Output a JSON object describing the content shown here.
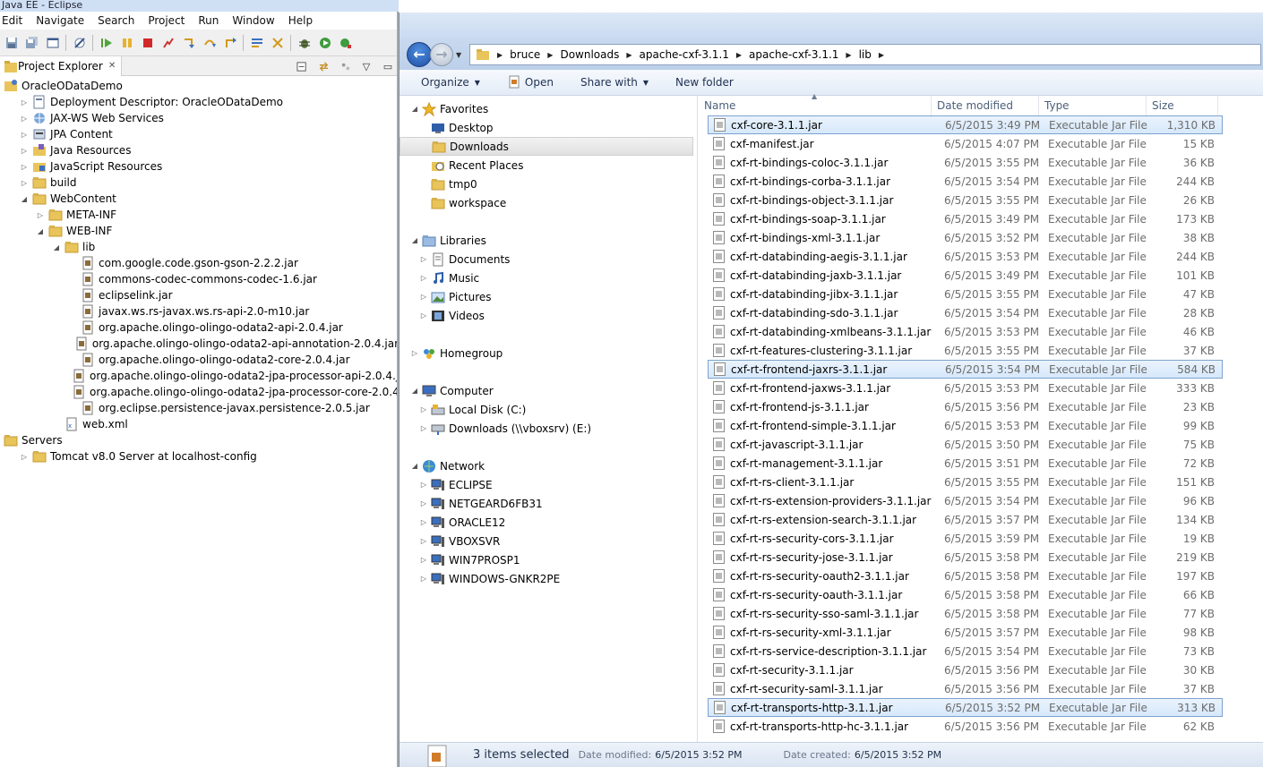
{
  "eclipse": {
    "title": "Java EE - Eclipse",
    "menu": [
      "Edit",
      "Navigate",
      "Search",
      "Project",
      "Run",
      "Window",
      "Help"
    ],
    "view_title": "Project Explorer",
    "view_close": "✕",
    "tree": [
      {
        "label": "OracleODataDemo",
        "level": 0,
        "twist": "",
        "icon": "project"
      },
      {
        "label": "Deployment Descriptor: OracleODataDemo",
        "level": 1,
        "twist": "closed",
        "icon": "descriptor"
      },
      {
        "label": "JAX-WS Web Services",
        "level": 1,
        "twist": "closed",
        "icon": "webservices"
      },
      {
        "label": "JPA Content",
        "level": 1,
        "twist": "closed",
        "icon": "jpa"
      },
      {
        "label": "Java Resources",
        "level": 1,
        "twist": "closed",
        "icon": "javares"
      },
      {
        "label": "JavaScript Resources",
        "level": 1,
        "twist": "closed",
        "icon": "jsres"
      },
      {
        "label": "build",
        "level": 1,
        "twist": "closed",
        "icon": "folder"
      },
      {
        "label": "WebContent",
        "level": 1,
        "twist": "open",
        "icon": "folder"
      },
      {
        "label": "META-INF",
        "level": 2,
        "twist": "closed",
        "icon": "folder"
      },
      {
        "label": "WEB-INF",
        "level": 2,
        "twist": "open",
        "icon": "folder"
      },
      {
        "label": "lib",
        "level": 3,
        "twist": "open",
        "icon": "folder"
      },
      {
        "label": "com.google.code.gson-gson-2.2.2.jar",
        "level": 4,
        "twist": "",
        "icon": "jar"
      },
      {
        "label": "commons-codec-commons-codec-1.6.jar",
        "level": 4,
        "twist": "",
        "icon": "jar"
      },
      {
        "label": "eclipselink.jar",
        "level": 4,
        "twist": "",
        "icon": "jar"
      },
      {
        "label": "javax.ws.rs-javax.ws.rs-api-2.0-m10.jar",
        "level": 4,
        "twist": "",
        "icon": "jar"
      },
      {
        "label": "org.apache.olingo-olingo-odata2-api-2.0.4.jar",
        "level": 4,
        "twist": "",
        "icon": "jar"
      },
      {
        "label": "org.apache.olingo-olingo-odata2-api-annotation-2.0.4.jar",
        "level": 4,
        "twist": "",
        "icon": "jar"
      },
      {
        "label": "org.apache.olingo-olingo-odata2-core-2.0.4.jar",
        "level": 4,
        "twist": "",
        "icon": "jar"
      },
      {
        "label": "org.apache.olingo-olingo-odata2-jpa-processor-api-2.0.4.jar",
        "level": 4,
        "twist": "",
        "icon": "jar"
      },
      {
        "label": "org.apache.olingo-olingo-odata2-jpa-processor-core-2.0.4.jar",
        "level": 4,
        "twist": "",
        "icon": "jar"
      },
      {
        "label": "org.eclipse.persistence-javax.persistence-2.0.5.jar",
        "level": 4,
        "twist": "",
        "icon": "jar"
      },
      {
        "label": "web.xml",
        "level": 3,
        "twist": "",
        "icon": "xml"
      },
      {
        "label": "Servers",
        "level": 0,
        "twist": "",
        "icon": "folder"
      },
      {
        "label": "Tomcat v8.0 Server at localhost-config",
        "level": 1,
        "twist": "closed",
        "icon": "folder"
      }
    ]
  },
  "explorer": {
    "breadcrumb": [
      "bruce",
      "Downloads",
      "apache-cxf-3.1.1",
      "apache-cxf-3.1.1",
      "lib"
    ],
    "commands": [
      {
        "label": "Organize",
        "dropdown": true,
        "icon": ""
      },
      {
        "label": "Open",
        "dropdown": false,
        "icon": "open"
      },
      {
        "label": "Share with",
        "dropdown": true,
        "icon": ""
      },
      {
        "label": "New folder",
        "dropdown": false,
        "icon": ""
      }
    ],
    "nav": [
      {
        "label": "Favorites",
        "level": 0,
        "twist": "open",
        "icon": "star",
        "gap": 0
      },
      {
        "label": "Desktop",
        "level": 1,
        "twist": "",
        "icon": "desktop",
        "gap": 0
      },
      {
        "label": "Downloads",
        "level": 1,
        "twist": "",
        "icon": "folder",
        "gap": 0,
        "selected": true
      },
      {
        "label": "Recent Places",
        "level": 1,
        "twist": "",
        "icon": "recent",
        "gap": 0
      },
      {
        "label": "tmp0",
        "level": 1,
        "twist": "",
        "icon": "folder",
        "gap": 0
      },
      {
        "label": "workspace",
        "level": 1,
        "twist": "",
        "icon": "folder",
        "gap": 0
      },
      {
        "label": "Libraries",
        "level": 0,
        "twist": "open",
        "icon": "library",
        "gap": 21
      },
      {
        "label": "Documents",
        "level": 1,
        "twist": "closed",
        "icon": "documents",
        "gap": 0
      },
      {
        "label": "Music",
        "level": 1,
        "twist": "closed",
        "icon": "music",
        "gap": 0
      },
      {
        "label": "Pictures",
        "level": 1,
        "twist": "closed",
        "icon": "pictures",
        "gap": 0
      },
      {
        "label": "Videos",
        "level": 1,
        "twist": "closed",
        "icon": "videos",
        "gap": 0
      },
      {
        "label": "Homegroup",
        "level": 0,
        "twist": "closed",
        "icon": "homegroup",
        "gap": 21
      },
      {
        "label": "Computer",
        "level": 0,
        "twist": "open",
        "icon": "computer",
        "gap": 21
      },
      {
        "label": "Local Disk (C:)",
        "level": 1,
        "twist": "closed",
        "icon": "disk",
        "gap": 0
      },
      {
        "label": "Downloads (\\\\vboxsrv) (E:)",
        "level": 1,
        "twist": "closed",
        "icon": "netdrive",
        "gap": 0
      },
      {
        "label": "Network",
        "level": 0,
        "twist": "open",
        "icon": "network",
        "gap": 21
      },
      {
        "label": "ECLIPSE",
        "level": 1,
        "twist": "closed",
        "icon": "pc",
        "gap": 0
      },
      {
        "label": "NETGEARD6FB31",
        "level": 1,
        "twist": "closed",
        "icon": "pc",
        "gap": 0
      },
      {
        "label": "ORACLE12",
        "level": 1,
        "twist": "closed",
        "icon": "pc",
        "gap": 0
      },
      {
        "label": "VBOXSVR",
        "level": 1,
        "twist": "closed",
        "icon": "pc",
        "gap": 0
      },
      {
        "label": "WIN7PROSP1",
        "level": 1,
        "twist": "closed",
        "icon": "pc",
        "gap": 0
      },
      {
        "label": "WINDOWS-GNKR2PE",
        "level": 1,
        "twist": "closed",
        "icon": "pc",
        "gap": 0
      }
    ],
    "columns": [
      "Name",
      "Date modified",
      "Type",
      "Size"
    ],
    "files": [
      {
        "name": "cxf-core-3.1.1.jar",
        "date": "6/5/2015 3:49 PM",
        "type": "Executable Jar File",
        "size": "1,310 KB",
        "selected": true
      },
      {
        "name": "cxf-manifest.jar",
        "date": "6/5/2015 4:07 PM",
        "type": "Executable Jar File",
        "size": "15 KB"
      },
      {
        "name": "cxf-rt-bindings-coloc-3.1.1.jar",
        "date": "6/5/2015 3:55 PM",
        "type": "Executable Jar File",
        "size": "36 KB"
      },
      {
        "name": "cxf-rt-bindings-corba-3.1.1.jar",
        "date": "6/5/2015 3:54 PM",
        "type": "Executable Jar File",
        "size": "244 KB"
      },
      {
        "name": "cxf-rt-bindings-object-3.1.1.jar",
        "date": "6/5/2015 3:55 PM",
        "type": "Executable Jar File",
        "size": "26 KB"
      },
      {
        "name": "cxf-rt-bindings-soap-3.1.1.jar",
        "date": "6/5/2015 3:49 PM",
        "type": "Executable Jar File",
        "size": "173 KB"
      },
      {
        "name": "cxf-rt-bindings-xml-3.1.1.jar",
        "date": "6/5/2015 3:52 PM",
        "type": "Executable Jar File",
        "size": "38 KB"
      },
      {
        "name": "cxf-rt-databinding-aegis-3.1.1.jar",
        "date": "6/5/2015 3:53 PM",
        "type": "Executable Jar File",
        "size": "244 KB"
      },
      {
        "name": "cxf-rt-databinding-jaxb-3.1.1.jar",
        "date": "6/5/2015 3:49 PM",
        "type": "Executable Jar File",
        "size": "101 KB"
      },
      {
        "name": "cxf-rt-databinding-jibx-3.1.1.jar",
        "date": "6/5/2015 3:55 PM",
        "type": "Executable Jar File",
        "size": "47 KB"
      },
      {
        "name": "cxf-rt-databinding-sdo-3.1.1.jar",
        "date": "6/5/2015 3:54 PM",
        "type": "Executable Jar File",
        "size": "28 KB"
      },
      {
        "name": "cxf-rt-databinding-xmlbeans-3.1.1.jar",
        "date": "6/5/2015 3:53 PM",
        "type": "Executable Jar File",
        "size": "46 KB"
      },
      {
        "name": "cxf-rt-features-clustering-3.1.1.jar",
        "date": "6/5/2015 3:55 PM",
        "type": "Executable Jar File",
        "size": "37 KB"
      },
      {
        "name": "cxf-rt-frontend-jaxrs-3.1.1.jar",
        "date": "6/5/2015 3:54 PM",
        "type": "Executable Jar File",
        "size": "584 KB",
        "selected": true
      },
      {
        "name": "cxf-rt-frontend-jaxws-3.1.1.jar",
        "date": "6/5/2015 3:53 PM",
        "type": "Executable Jar File",
        "size": "333 KB"
      },
      {
        "name": "cxf-rt-frontend-js-3.1.1.jar",
        "date": "6/5/2015 3:56 PM",
        "type": "Executable Jar File",
        "size": "23 KB"
      },
      {
        "name": "cxf-rt-frontend-simple-3.1.1.jar",
        "date": "6/5/2015 3:53 PM",
        "type": "Executable Jar File",
        "size": "99 KB"
      },
      {
        "name": "cxf-rt-javascript-3.1.1.jar",
        "date": "6/5/2015 3:50 PM",
        "type": "Executable Jar File",
        "size": "75 KB"
      },
      {
        "name": "cxf-rt-management-3.1.1.jar",
        "date": "6/5/2015 3:51 PM",
        "type": "Executable Jar File",
        "size": "72 KB"
      },
      {
        "name": "cxf-rt-rs-client-3.1.1.jar",
        "date": "6/5/2015 3:55 PM",
        "type": "Executable Jar File",
        "size": "151 KB"
      },
      {
        "name": "cxf-rt-rs-extension-providers-3.1.1.jar",
        "date": "6/5/2015 3:54 PM",
        "type": "Executable Jar File",
        "size": "96 KB"
      },
      {
        "name": "cxf-rt-rs-extension-search-3.1.1.jar",
        "date": "6/5/2015 3:57 PM",
        "type": "Executable Jar File",
        "size": "134 KB"
      },
      {
        "name": "cxf-rt-rs-security-cors-3.1.1.jar",
        "date": "6/5/2015 3:59 PM",
        "type": "Executable Jar File",
        "size": "19 KB"
      },
      {
        "name": "cxf-rt-rs-security-jose-3.1.1.jar",
        "date": "6/5/2015 3:58 PM",
        "type": "Executable Jar File",
        "size": "219 KB"
      },
      {
        "name": "cxf-rt-rs-security-oauth2-3.1.1.jar",
        "date": "6/5/2015 3:58 PM",
        "type": "Executable Jar File",
        "size": "197 KB"
      },
      {
        "name": "cxf-rt-rs-security-oauth-3.1.1.jar",
        "date": "6/5/2015 3:58 PM",
        "type": "Executable Jar File",
        "size": "66 KB"
      },
      {
        "name": "cxf-rt-rs-security-sso-saml-3.1.1.jar",
        "date": "6/5/2015 3:58 PM",
        "type": "Executable Jar File",
        "size": "77 KB"
      },
      {
        "name": "cxf-rt-rs-security-xml-3.1.1.jar",
        "date": "6/5/2015 3:57 PM",
        "type": "Executable Jar File",
        "size": "98 KB"
      },
      {
        "name": "cxf-rt-rs-service-description-3.1.1.jar",
        "date": "6/5/2015 3:54 PM",
        "type": "Executable Jar File",
        "size": "73 KB"
      },
      {
        "name": "cxf-rt-security-3.1.1.jar",
        "date": "6/5/2015 3:56 PM",
        "type": "Executable Jar File",
        "size": "30 KB"
      },
      {
        "name": "cxf-rt-security-saml-3.1.1.jar",
        "date": "6/5/2015 3:56 PM",
        "type": "Executable Jar File",
        "size": "37 KB"
      },
      {
        "name": "cxf-rt-transports-http-3.1.1.jar",
        "date": "6/5/2015 3:52 PM",
        "type": "Executable Jar File",
        "size": "313 KB",
        "selected": true
      },
      {
        "name": "cxf-rt-transports-http-hc-3.1.1.jar",
        "date": "6/5/2015 3:56 PM",
        "type": "Executable Jar File",
        "size": "62 KB"
      }
    ],
    "status": {
      "selection": "3 items selected",
      "modified_label": "Date modified:",
      "modified_value": "6/5/2015 3:52 PM",
      "created_label": "Date created:",
      "created_value": "6/5/2015 3:52 PM"
    }
  },
  "colors": {
    "selection_bg": "#d6e8fb",
    "selection_border": "#7da2ce",
    "folder": "#e8c45a",
    "secondary_text": "#6d6d6d"
  }
}
